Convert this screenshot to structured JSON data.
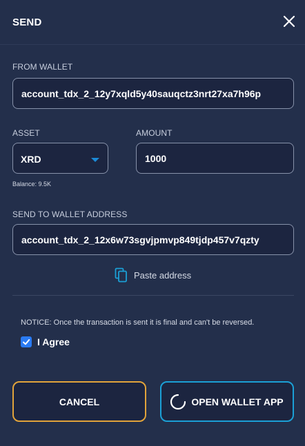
{
  "dialog": {
    "title": "SEND"
  },
  "from_wallet": {
    "label": "FROM WALLET",
    "value": "account_tdx_2_12y7xqld5y40sauqctz3nrt27xa7h96p"
  },
  "asset": {
    "label": "ASSET",
    "selected": "XRD",
    "balance": "Balance: 9.5K"
  },
  "amount": {
    "label": "AMOUNT",
    "value": "1000"
  },
  "send_to": {
    "label": "SEND TO WALLET ADDRESS",
    "value": "account_tdx_2_12x6w73sgvjpmvp849tjdp457v7qzty",
    "paste_label": "Paste address"
  },
  "notice": {
    "text": "NOTICE: Once the transaction is sent it is final and can't be reversed.",
    "agree_label": "I Agree",
    "agree_checked": true
  },
  "buttons": {
    "cancel_label": "CANCEL",
    "open_wallet_label": "OPEN WALLET APP"
  },
  "colors": {
    "background": "#232f4b",
    "field_border": "#8792aa",
    "cancel_border": "#e2a43a",
    "open_wallet_border": "#1ba0d6",
    "accent": "#1b8ad6",
    "checkbox": "#2a7bf4"
  },
  "icons": {
    "close": "close-icon",
    "caret": "chevron-down-icon",
    "paste": "copy-icon",
    "spinner": "loading-spinner-icon",
    "check": "check-icon"
  }
}
